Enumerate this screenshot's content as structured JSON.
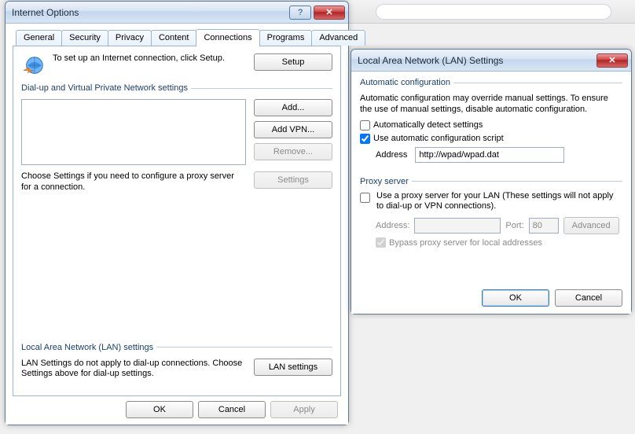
{
  "bgStrip": {
    "placeholder": ""
  },
  "io": {
    "title": "Internet Options",
    "helpGlyph": "?",
    "closeGlyph": "✕",
    "tabs": [
      "General",
      "Security",
      "Privacy",
      "Content",
      "Connections",
      "Programs",
      "Advanced"
    ],
    "activeTab": "Connections",
    "setupText": "To set up an Internet connection, click Setup.",
    "setupBtn": "Setup",
    "groups": {
      "dialup": {
        "legend": "Dial-up and Virtual Private Network settings",
        "addBtn": "Add...",
        "addVpnBtn": "Add VPN...",
        "removeBtn": "Remove...",
        "settingsBtn": "Settings",
        "chooseText": "Choose Settings if you need to configure a proxy server for a connection."
      },
      "lan": {
        "legend": "Local Area Network (LAN) settings",
        "text": "LAN Settings do not apply to dial-up connections. Choose Settings above for dial-up settings.",
        "btn": "LAN settings"
      }
    },
    "bottom": {
      "ok": "OK",
      "cancel": "Cancel",
      "apply": "Apply"
    }
  },
  "lan": {
    "title": "Local Area Network (LAN) Settings",
    "closeGlyph": "✕",
    "auto": {
      "legend": "Automatic configuration",
      "hint": "Automatic configuration may override manual settings.  To ensure the use of manual settings, disable automatic configuration.",
      "detectLabel": "Automatically detect settings",
      "detectChecked": false,
      "scriptLabel": "Use automatic configuration script",
      "scriptChecked": true,
      "addressLabel": "Address",
      "addressValue": "http://wpad/wpad.dat"
    },
    "proxy": {
      "legend": "Proxy server",
      "useLabel": "Use a proxy server for your LAN (These settings will not apply to dial-up or VPN connections).",
      "useChecked": false,
      "addressLabel": "Address:",
      "addressValue": "",
      "portLabel": "Port:",
      "portValue": "80",
      "advancedBtn": "Advanced",
      "bypassLabel": "Bypass proxy server for local addresses",
      "bypassChecked": true
    },
    "bottom": {
      "ok": "OK",
      "cancel": "Cancel"
    }
  }
}
